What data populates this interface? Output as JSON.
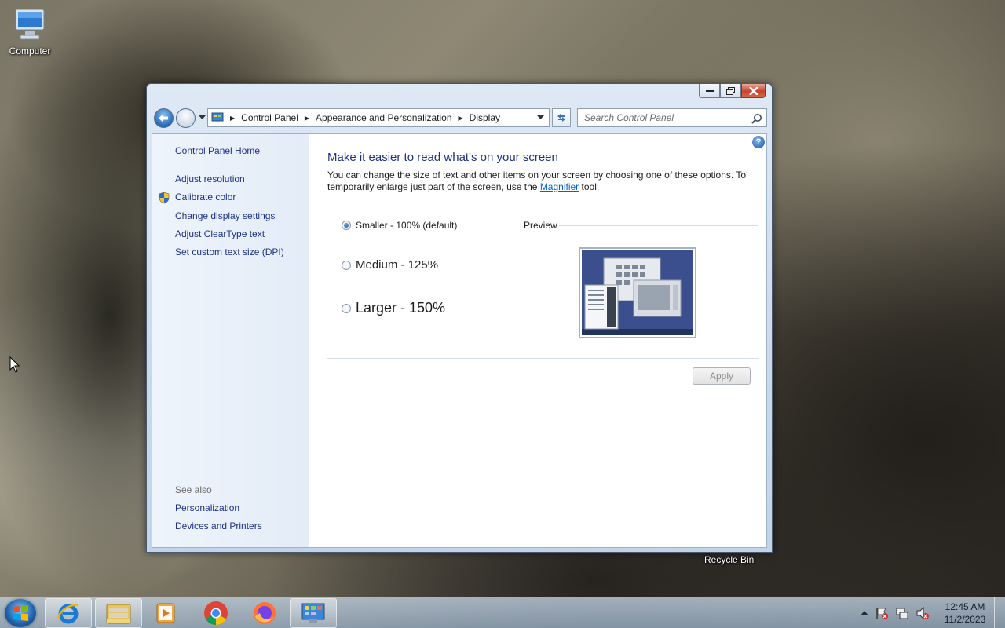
{
  "desktop": {
    "computer_label": "Computer",
    "recycle_label": "Recycle Bin"
  },
  "window": {
    "address": {
      "root_icon": "control-panel-icon",
      "crumbs": [
        "Control Panel",
        "Appearance and Personalization",
        "Display"
      ]
    },
    "search_placeholder": "Search Control Panel",
    "left_pane": {
      "home": "Control Panel Home",
      "links": [
        "Adjust resolution",
        "Calibrate color",
        "Change display settings",
        "Adjust ClearType text",
        "Set custom text size (DPI)"
      ],
      "see_also_label": "See also",
      "see_also": [
        "Personalization",
        "Devices and Printers"
      ]
    },
    "content": {
      "heading": "Make it easier to read what's on your screen",
      "desc_before": "You can change the size of text and other items on your screen by choosing one of these options. To temporarily enlarge just part of the screen, use the ",
      "desc_link": "Magnifier",
      "desc_after": " tool.",
      "options": [
        {
          "label": "Smaller - 100% (default)",
          "selected": true
        },
        {
          "label": "Medium - 125%",
          "selected": false
        },
        {
          "label": "Larger - 150%",
          "selected": false
        }
      ],
      "preview_label": "Preview",
      "apply_label": "Apply",
      "help_icon": "?"
    }
  },
  "taskbar": {
    "apps": [
      "internet-explorer-icon",
      "file-explorer-icon",
      "media-player-icon",
      "chrome-icon",
      "firefox-icon",
      "control-panel-icon"
    ],
    "clock_time": "12:45 AM",
    "clock_date": "11/2/2023"
  }
}
